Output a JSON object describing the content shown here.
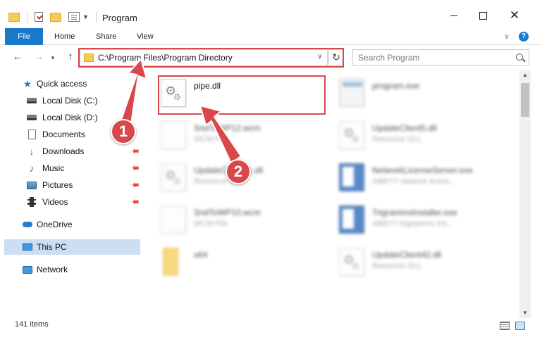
{
  "window": {
    "title": "Program"
  },
  "ribbon": {
    "tabs": [
      "File",
      "Home",
      "Share",
      "View"
    ],
    "help_label": "?"
  },
  "address": {
    "path": "C:\\Program Files\\Program Directory"
  },
  "search": {
    "placeholder": "Search Program"
  },
  "sidebar": {
    "items": [
      {
        "label": "Quick access",
        "icon": "star-icon"
      },
      {
        "label": "Local Disk (C:)",
        "icon": "drive-icon"
      },
      {
        "label": "Local Disk (D:)",
        "icon": "drive-icon"
      },
      {
        "label": "Documents",
        "icon": "documents-icon"
      },
      {
        "label": "Downloads",
        "icon": "downloads-icon"
      },
      {
        "label": "Music",
        "icon": "music-icon"
      },
      {
        "label": "Pictures",
        "icon": "pictures-icon"
      },
      {
        "label": "Videos",
        "icon": "videos-icon"
      },
      {
        "label": "OneDrive",
        "icon": "cloud-icon"
      },
      {
        "label": "This PC",
        "icon": "computer-icon"
      },
      {
        "label": "Network",
        "icon": "network-icon"
      }
    ]
  },
  "files": [
    {
      "name": "pipe.dll",
      "type": "",
      "icon": "dll-icon"
    },
    {
      "name": "program.exe",
      "type": "",
      "icon": "exe-icon"
    },
    {
      "name": "SndToWP12.wcm",
      "type": "WCM File",
      "icon": "document-icon"
    },
    {
      "name": "UpdateClient5.dll",
      "type": "Resource DLL",
      "icon": "dll-icon"
    },
    {
      "name": "UpdateClient41.dll",
      "type": "Resource DLL",
      "icon": "dll-icon"
    },
    {
      "name": "NetworkLicenseServer.exe",
      "type": "ABBYY network licens...",
      "icon": "exe-icon"
    },
    {
      "name": "SndToWP10.wcm",
      "type": "WCM File",
      "icon": "document-icon"
    },
    {
      "name": "TrigrammsInstaller.exe",
      "type": "ABBYY trigramms ins...",
      "icon": "exe-icon"
    },
    {
      "name": "x64",
      "type": "",
      "icon": "folder-icon"
    },
    {
      "name": "UpdateClient42.dll",
      "type": "Resource DLL",
      "icon": "dll-icon"
    }
  ],
  "callouts": [
    "1",
    "2"
  ],
  "status": {
    "item_count": "141 items"
  },
  "colors": {
    "accent": "#1979ca",
    "highlight": "#d9474b",
    "selected": "#ccdef1"
  }
}
